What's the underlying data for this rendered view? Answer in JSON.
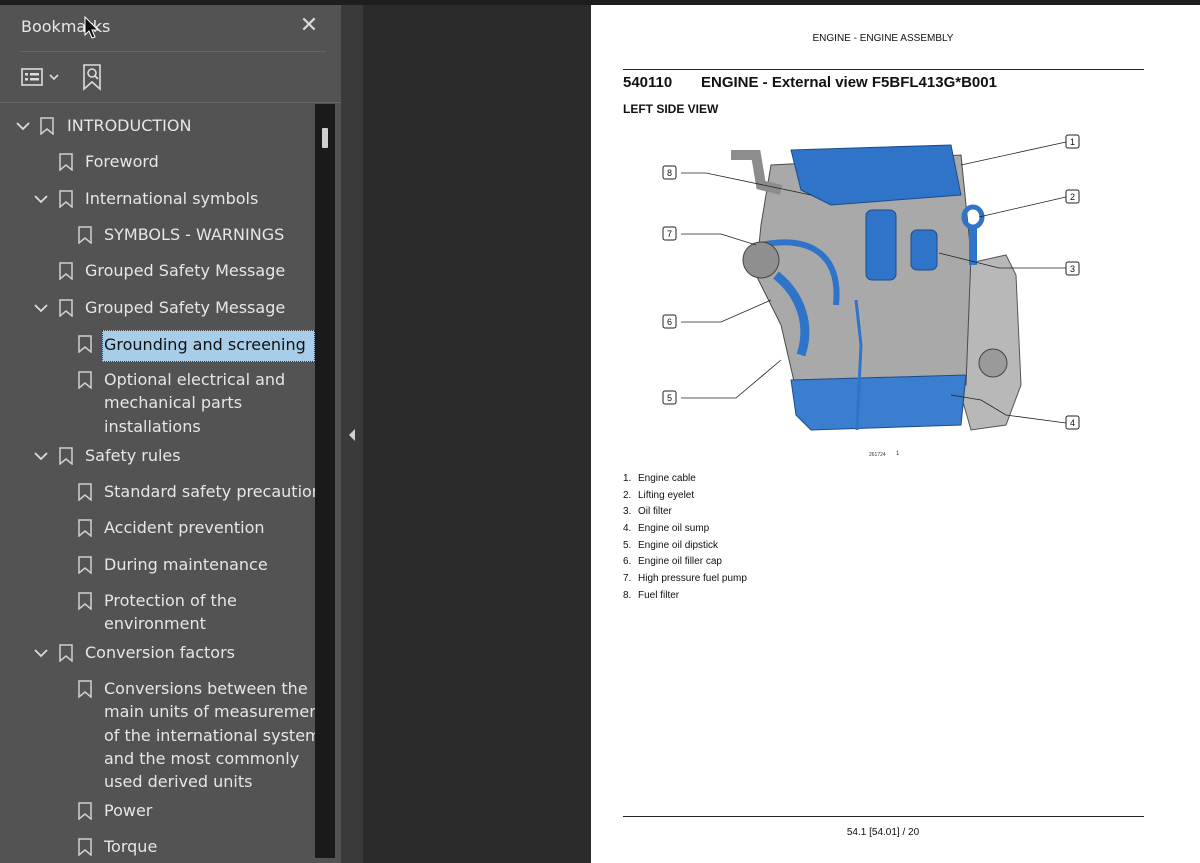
{
  "panel": {
    "title": "Bookmarks",
    "items": [
      {
        "label": "INTRODUCTION"
      },
      {
        "label": "Foreword"
      },
      {
        "label": "International symbols"
      },
      {
        "label": "SYMBOLS - WARNINGS"
      },
      {
        "label": "Grouped Safety Message"
      },
      {
        "label": "Grouped Safety Message"
      },
      {
        "label": "Grounding and screening",
        "selected": true
      },
      {
        "label_lines": [
          "Optional electrical and",
          "mechanical parts",
          "installations"
        ]
      },
      {
        "label": "Safety rules"
      },
      {
        "label": "Standard safety precautions"
      },
      {
        "label": "Accident prevention"
      },
      {
        "label": "During maintenance"
      },
      {
        "label_lines": [
          "Protection of the",
          "environment"
        ]
      },
      {
        "label": "Conversion factors"
      },
      {
        "label_lines": [
          "Conversions between the",
          "main units of measurements",
          "of the international system",
          "and the most commonly",
          "used derived units"
        ]
      },
      {
        "label": "Power"
      },
      {
        "label": "Torque"
      }
    ]
  },
  "document": {
    "running_head": "ENGINE - ENGINE ASSEMBLY",
    "section_code": "540110",
    "section_title": "ENGINE - External view F5BFL413G*B001",
    "subtitle": "LEFT SIDE VIEW",
    "figure": {
      "code": "261724",
      "number": "1",
      "callouts": [
        "1",
        "2",
        "3",
        "4",
        "5",
        "6",
        "7",
        "8"
      ]
    },
    "legend": [
      {
        "n": "1.",
        "text": "Engine cable"
      },
      {
        "n": "2.",
        "text": "Lifting eyelet"
      },
      {
        "n": "3.",
        "text": "Oil filter"
      },
      {
        "n": "4.",
        "text": "Engine oil sump"
      },
      {
        "n": "5.",
        "text": "Engine oil dipstick"
      },
      {
        "n": "6.",
        "text": "Engine oil filler cap"
      },
      {
        "n": "7.",
        "text": "High pressure fuel pump"
      },
      {
        "n": "8.",
        "text": "Fuel filter"
      }
    ],
    "page_number": "54.1 [54.01] / 20"
  },
  "colors": {
    "panel_bg": "#535353",
    "selection": "#a8cde8",
    "engine_blue": "#2f74c8",
    "engine_grey": "#9a9a9a"
  }
}
